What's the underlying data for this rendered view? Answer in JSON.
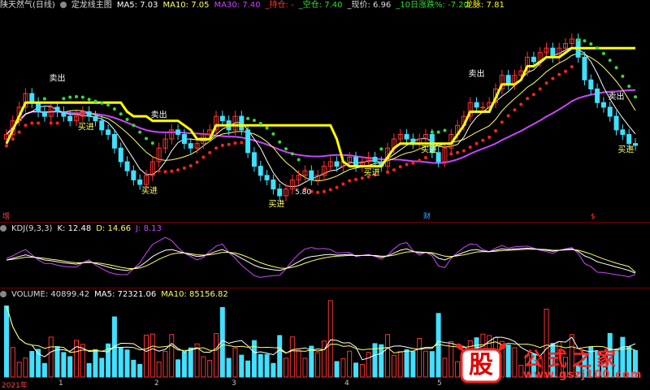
{
  "app": {
    "stock_name": "陕天然气(日线)",
    "indicator_name": "定龙线主图"
  },
  "main_header": {
    "ma5": "MA5: 7.03",
    "ma10": "MA10: 7.05",
    "ma30": "MA30: 7.40",
    "hold": "_持仓: -",
    "empty": "_空仓: 7.40",
    "price": "_现价: 6.96",
    "chg10": "_10日涨跌%: -7.20",
    "longmai": "龙脉: 7.81"
  },
  "kdj_header": {
    "name": "KDJ(9,3,3)",
    "k": "K: 12.48",
    "d": "D: 14.66",
    "j": "J: 8.13"
  },
  "vol_header": {
    "name": "VOLUME: 40899.42",
    "ma5": "MA5: 72321.06",
    "ma10": "MA10: 85156.82"
  },
  "markers": {
    "zeng": "增",
    "cai": "财",
    "icon3": "$"
  },
  "low_label": "5.80",
  "x_axis": [
    "2021年",
    "1",
    "2",
    "3",
    "4",
    "5"
  ],
  "logo": {
    "text": "公式之家",
    "url": "www.gszj100.com",
    "icon": "股"
  },
  "signals": {
    "sell": "卖出",
    "buy": "买进"
  },
  "colors": {
    "up": "#ff3333",
    "down": "#40e0ff",
    "ma5": "#ffffff",
    "ma10": "#ffff66",
    "ma30": "#cc44ff",
    "dragon": "#ffff00",
    "green_dot": "#33dd33",
    "red_dot": "#ff2222",
    "k": "#ffffff",
    "d": "#ffff66",
    "j": "#cc44ff"
  },
  "chart_data": {
    "type": "candlestick",
    "x_labels": [
      "2021年",
      "1",
      "2",
      "3",
      "4",
      "5"
    ],
    "closes": [
      7.2,
      7.5,
      7.8,
      8.1,
      7.9,
      7.7,
      7.6,
      7.8,
      7.7,
      7.6,
      7.5,
      7.6,
      7.7,
      7.6,
      7.5,
      7.3,
      7.2,
      6.9,
      6.6,
      6.4,
      6.2,
      6.1,
      6.3,
      6.6,
      6.9,
      7.1,
      7.3,
      7.2,
      7.0,
      6.9,
      7.0,
      7.2,
      7.3,
      7.6,
      7.5,
      7.3,
      7.6,
      7.3,
      6.8,
      6.5,
      6.3,
      6.2,
      6.0,
      5.85,
      6.0,
      6.2,
      6.3,
      6.4,
      6.2,
      6.3,
      6.5,
      6.6,
      6.5,
      6.6,
      6.7,
      6.5,
      6.6,
      6.7,
      6.6,
      6.5,
      6.9,
      7.1,
      7.2,
      7.1,
      7.0,
      7.1,
      7.2,
      6.8,
      6.6,
      6.9,
      7.2,
      7.4,
      7.6,
      7.9,
      7.8,
      7.8,
      7.9,
      8.2,
      8.5,
      8.3,
      8.5,
      8.6,
      8.9,
      8.8,
      9.0,
      9.1,
      8.9,
      9.1,
      9.2,
      9.3,
      8.9,
      8.4,
      8.2,
      7.9,
      7.8,
      7.6,
      7.3,
      7.2,
      7.0,
      6.96
    ],
    "kdj": {
      "K": [
        50,
        55,
        60,
        65,
        60,
        55,
        50,
        48,
        45,
        42,
        40,
        38,
        42,
        45,
        40,
        35,
        30,
        25,
        22,
        20,
        25,
        32,
        45,
        60,
        70,
        78,
        80,
        75,
        70,
        65,
        60,
        62,
        68,
        75,
        80,
        72,
        65,
        55,
        45,
        35,
        28,
        25,
        22,
        20,
        25,
        35,
        45,
        55,
        60,
        62,
        65,
        66,
        64,
        65,
        66,
        62,
        63,
        64,
        62,
        58,
        62,
        70,
        78,
        82,
        75,
        70,
        72,
        68,
        55,
        50,
        58,
        65,
        72,
        78,
        80,
        76,
        74,
        78,
        82,
        80,
        82,
        83,
        84,
        82,
        80,
        78,
        75,
        78,
        80,
        82,
        75,
        62,
        55,
        45,
        40,
        35,
        30,
        25,
        20,
        12.48
      ],
      "D": [
        50,
        52,
        55,
        58,
        58,
        57,
        55,
        52,
        50,
        47,
        44,
        42,
        42,
        43,
        42,
        40,
        37,
        33,
        29,
        26,
        25,
        27,
        33,
        42,
        52,
        60,
        67,
        70,
        70,
        68,
        65,
        64,
        65,
        68,
        72,
        72,
        70,
        65,
        58,
        50,
        42,
        36,
        31,
        27,
        26,
        29,
        34,
        41,
        47,
        52,
        56,
        59,
        61,
        62,
        63,
        63,
        63,
        63,
        63,
        61,
        61,
        64,
        69,
        73,
        74,
        73,
        72,
        71,
        66,
        61,
        60,
        62,
        65,
        69,
        73,
        74,
        74,
        75,
        77,
        78,
        79,
        80,
        81,
        81,
        81,
        80,
        78,
        78,
        79,
        80,
        78,
        73,
        67,
        60,
        53,
        47,
        41,
        36,
        31,
        14.66
      ],
      "J": [
        55,
        62,
        72,
        80,
        65,
        50,
        40,
        40,
        35,
        32,
        30,
        30,
        42,
        50,
        36,
        25,
        16,
        10,
        8,
        8,
        25,
        42,
        70,
        95,
        105,
        115,
        106,
        86,
        70,
        60,
        50,
        58,
        75,
        90,
        96,
        72,
        55,
        35,
        20,
        5,
        0,
        3,
        5,
        6,
        25,
        48,
        67,
        82,
        86,
        82,
        83,
        80,
        70,
        71,
        72,
        60,
        63,
        66,
        60,
        52,
        64,
        82,
        96,
        100,
        77,
        64,
        72,
        62,
        33,
        28,
        55,
        72,
        86,
        96,
        94,
        80,
        74,
        84,
        92,
        84,
        88,
        89,
        90,
        84,
        78,
        74,
        69,
        78,
        82,
        86,
        69,
        40,
        31,
        15,
        14,
        11,
        8,
        5,
        2,
        8.13
      ]
    },
    "volume_ma5": 72321.06,
    "volume_ma10": 85156.82,
    "volume_last": 40899.42,
    "price_low": 5.8,
    "price_last": 6.96
  }
}
